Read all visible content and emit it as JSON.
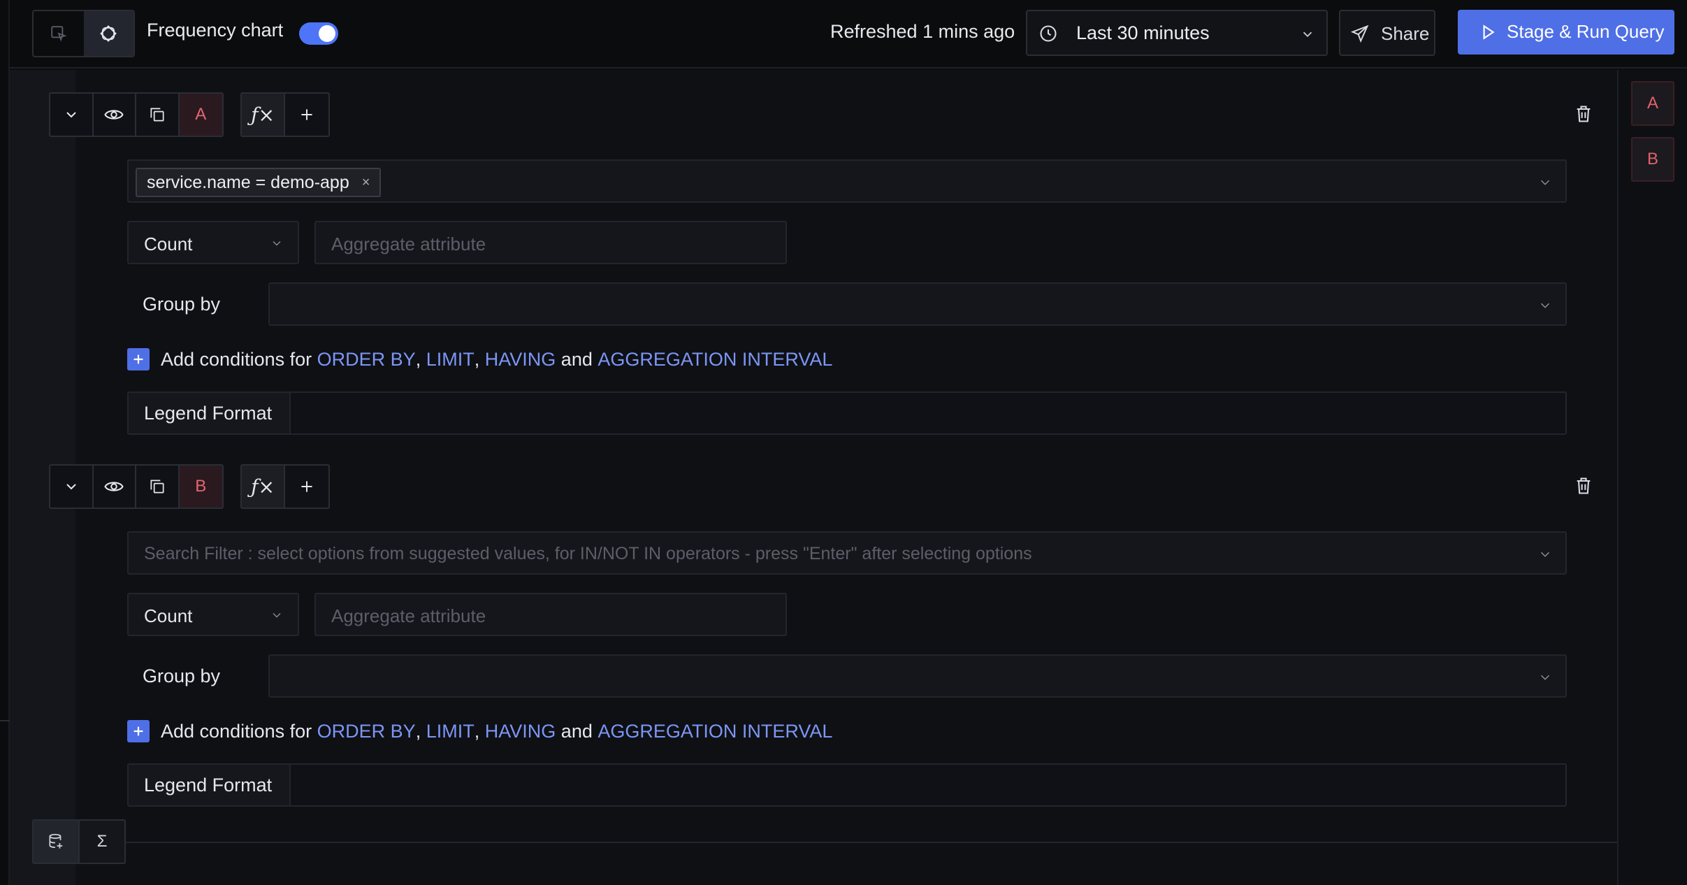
{
  "header": {
    "frequency_chart_label": "Frequency chart",
    "frequency_chart_enabled": true,
    "refreshed_text": "Refreshed 1 mins ago",
    "time_range": "Last 30 minutes",
    "share_label": "Share",
    "run_label": "Stage & Run Query",
    "accent_color": "#4e6fe6"
  },
  "queries": [
    {
      "name": "A",
      "function_icon": "ƒ×",
      "filter_tag": "service.name = demo-app",
      "filter_tag_remove": "×",
      "filter_placeholder": "",
      "aggregate_operator": "Count",
      "aggregate_attribute_placeholder": "Aggregate attribute",
      "group_by_label": "Group by",
      "add_conditions": {
        "prefix": "Add conditions for",
        "order_by": "ORDER BY",
        "comma": ",",
        "limit": "LIMIT",
        "having": "HAVING",
        "and": "and",
        "interval": "AGGREGATION INTERVAL"
      },
      "legend_format_label": "Legend Format"
    },
    {
      "name": "B",
      "function_icon": "ƒ×",
      "filter_tag": "",
      "filter_placeholder": "Search Filter : select options from suggested values, for IN/NOT IN operators - press \"Enter\" after selecting options",
      "aggregate_operator": "Count",
      "aggregate_attribute_placeholder": "Aggregate attribute",
      "group_by_label": "Group by",
      "add_conditions": {
        "prefix": "Add conditions for",
        "order_by": "ORDER BY",
        "comma": ",",
        "limit": "LIMIT",
        "having": "HAVING",
        "and": "and",
        "interval": "AGGREGATION INTERVAL"
      },
      "legend_format_label": "Legend Format"
    }
  ],
  "side_badges": [
    "A",
    "B"
  ],
  "bottom_tools": {
    "sigma": "Σ"
  },
  "icons": [
    "query-builder-icon",
    "formula-mode-icon",
    "chevron-down-icon",
    "eye-icon",
    "copy-icon",
    "function-icon",
    "plus-icon",
    "trash-icon",
    "clock-icon",
    "send-icon",
    "play-icon",
    "database-icon",
    "sigma-icon"
  ]
}
